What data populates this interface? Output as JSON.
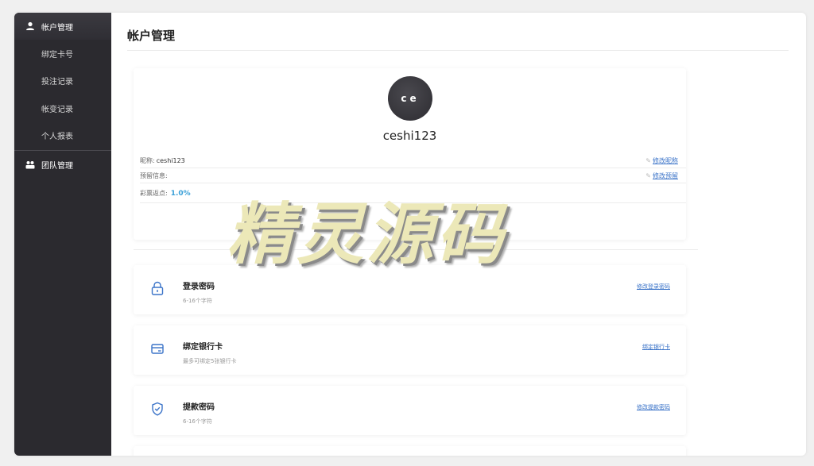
{
  "sidebar": {
    "groups": [
      {
        "label": "帐户管理",
        "icon": "user-icon"
      },
      {
        "label": "团队管理",
        "icon": "team-icon"
      }
    ],
    "items": [
      {
        "label": "绑定卡号"
      },
      {
        "label": "投注记录"
      },
      {
        "label": "帐变记录"
      },
      {
        "label": "个人报表"
      }
    ]
  },
  "page": {
    "title": "帐户管理"
  },
  "profile": {
    "avatar_text": "ce",
    "username": "ceshi123",
    "nickname_label": "昵称:",
    "nickname_value": "ceshi123",
    "nickname_link": "修改昵称",
    "reserved_label": "预留信息:",
    "reserved_link": "修改预留",
    "rebate_label": "彩票返点:",
    "rebate_value": "1.0%"
  },
  "security": [
    {
      "title": "登录密码",
      "subtitle": "6-16个字符",
      "link": "修改登录密码",
      "icon": "lock-icon"
    },
    {
      "title": "绑定银行卡",
      "subtitle": "最多可绑定5张银行卡",
      "link": "绑定银行卡",
      "icon": "card-icon"
    },
    {
      "title": "提款密码",
      "subtitle": "6-16个字符",
      "link": "修改提款密码",
      "icon": "shield-icon"
    }
  ],
  "watermark": "精灵源码",
  "colors": {
    "sidebar_bg": "#2b2a2f",
    "link": "#3a73c8",
    "rate": "#3aa0d8"
  }
}
